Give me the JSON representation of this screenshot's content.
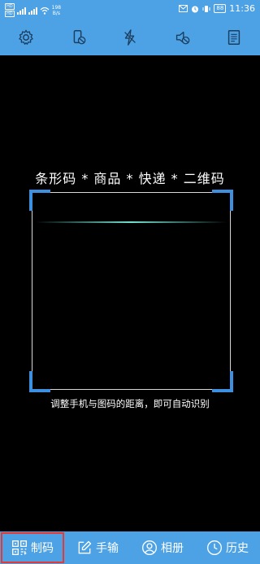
{
  "status_bar": {
    "sim1": "HD",
    "sim2": "HD",
    "net": "4G",
    "speed_value": "198",
    "speed_unit": "B/s",
    "battery": "88",
    "time": "11:36"
  },
  "toolbar": {
    "items": [
      {
        "icon": "gear-icon"
      },
      {
        "icon": "phone-vibrate-icon"
      },
      {
        "icon": "flash-off-icon"
      },
      {
        "icon": "sound-off-icon"
      },
      {
        "icon": "document-icon"
      }
    ]
  },
  "scanner": {
    "title": "条形码 * 商品 * 快递 * 二维码",
    "hint": "调整手机与图码的距离，即可自动识别"
  },
  "tabs": [
    {
      "label": "制码",
      "icon": "qr-code-icon",
      "active": true
    },
    {
      "label": "手输",
      "icon": "edit-icon",
      "active": false
    },
    {
      "label": "相册",
      "icon": "user-circle-icon",
      "active": false
    },
    {
      "label": "历史",
      "icon": "clock-icon",
      "active": false
    }
  ],
  "colors": {
    "bar_blue": "#4da2e6",
    "corner_blue": "#3d8fe0",
    "scan_line": "#6fe0d0",
    "active_outline": "#e53935"
  }
}
